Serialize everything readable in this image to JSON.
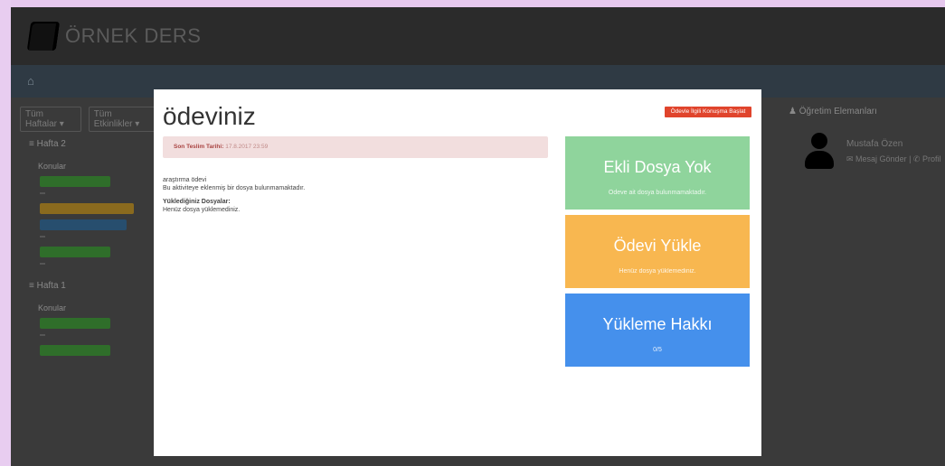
{
  "app": {
    "title": "ÖRNEK DERS"
  },
  "sidebar": {
    "filters": [
      "Tüm Haftalar ▾",
      "Tüm Etkinlikler ▾"
    ],
    "weeks": [
      {
        "title": "≡ Hafta 2",
        "section": "Konular"
      },
      {
        "title": "≡ Hafta 1",
        "section": "Konular"
      }
    ]
  },
  "right_panel": {
    "title": "♟ Öğretim Elemanları",
    "user_name": "Mustafa Özen",
    "user_meta": "✉ Mesaj Gönder  |  ✆ Profil"
  },
  "modal": {
    "title": "ödeviniz",
    "top_button": "Ödevle İlgili Konuşma Başlat",
    "deadline_label": "Son Teslim Tarihi:",
    "deadline_value": "17.8.2017 23:59",
    "line1": "araştırma ödevi",
    "line2": "Bu aktiviteye eklenmiş bir dosya bulunmamaktadır.",
    "uploaded_title": "Yüklediğiniz Dosyalar:",
    "uploaded_text": "Henüz dosya yüklemediniz.",
    "tiles": [
      {
        "big": "Ekli Dosya Yok",
        "small": "Ödeve ait dosya bulunmamaktadır.",
        "color": "#8fd49c"
      },
      {
        "big": "Ödevi Yükle",
        "small": "Henüz dosya yüklemediniz.",
        "color": "#f8b750"
      },
      {
        "big": "Yükleme Hakkı",
        "small": "0/5",
        "color": "#4590ec"
      }
    ]
  }
}
